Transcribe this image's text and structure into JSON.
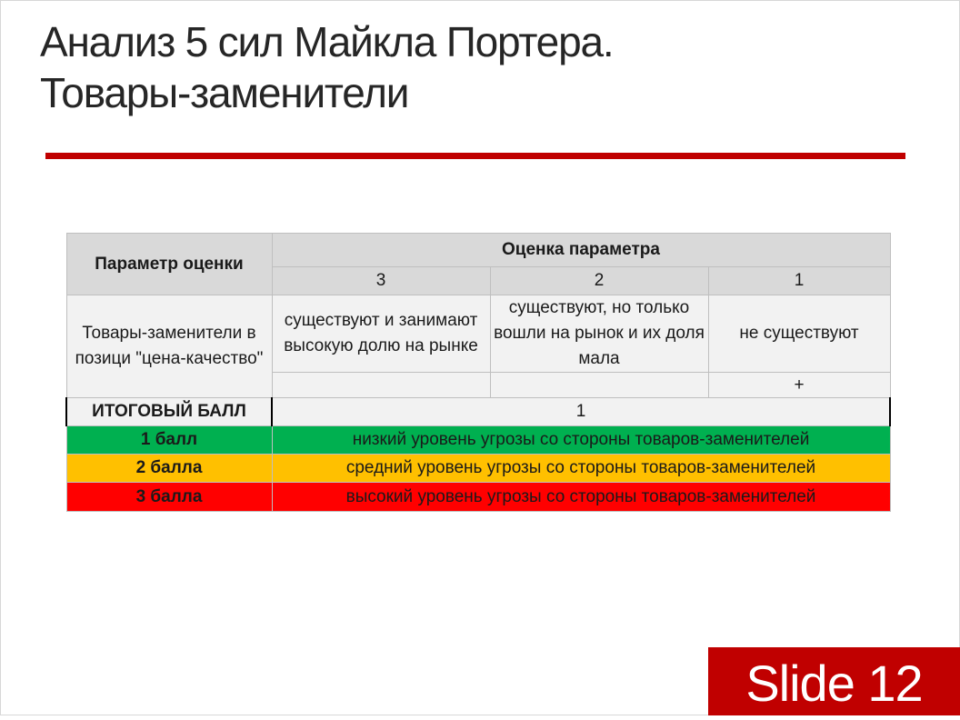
{
  "slide": {
    "title_line1": "Анализ 5 сил Майкла Портера.",
    "title_line2": "Товары-заменители",
    "badge": "Slide 12"
  },
  "table": {
    "param_header": "Параметр оценки",
    "score_header": "Оценка параметра",
    "score_cols": [
      "3",
      "2",
      "1"
    ],
    "parameter": "Товары-заменители в позици \"цена-качество\"",
    "options": [
      "существуют и занимают высокую долю на рынке",
      "существуют, но только вошли на рынок и их доля мала",
      "не существуют"
    ],
    "marks": [
      "",
      "",
      "+"
    ],
    "total_label": "ИТОГОВЫЙ БАЛЛ",
    "total_value": "1",
    "levels": [
      {
        "label": "1 балл",
        "text": "низкий уровень угрозы со стороны товаров-заменителей",
        "color": "#00b050"
      },
      {
        "label": "2 балла",
        "text": "средний уровень угрозы со стороны товаров-заменителей",
        "color": "#ffc000"
      },
      {
        "label": "3 балла",
        "text": "высокий уровень угрозы со стороны товаров-заменителей",
        "color": "#ff0000"
      }
    ]
  },
  "colors": {
    "accent": "#c00000"
  }
}
